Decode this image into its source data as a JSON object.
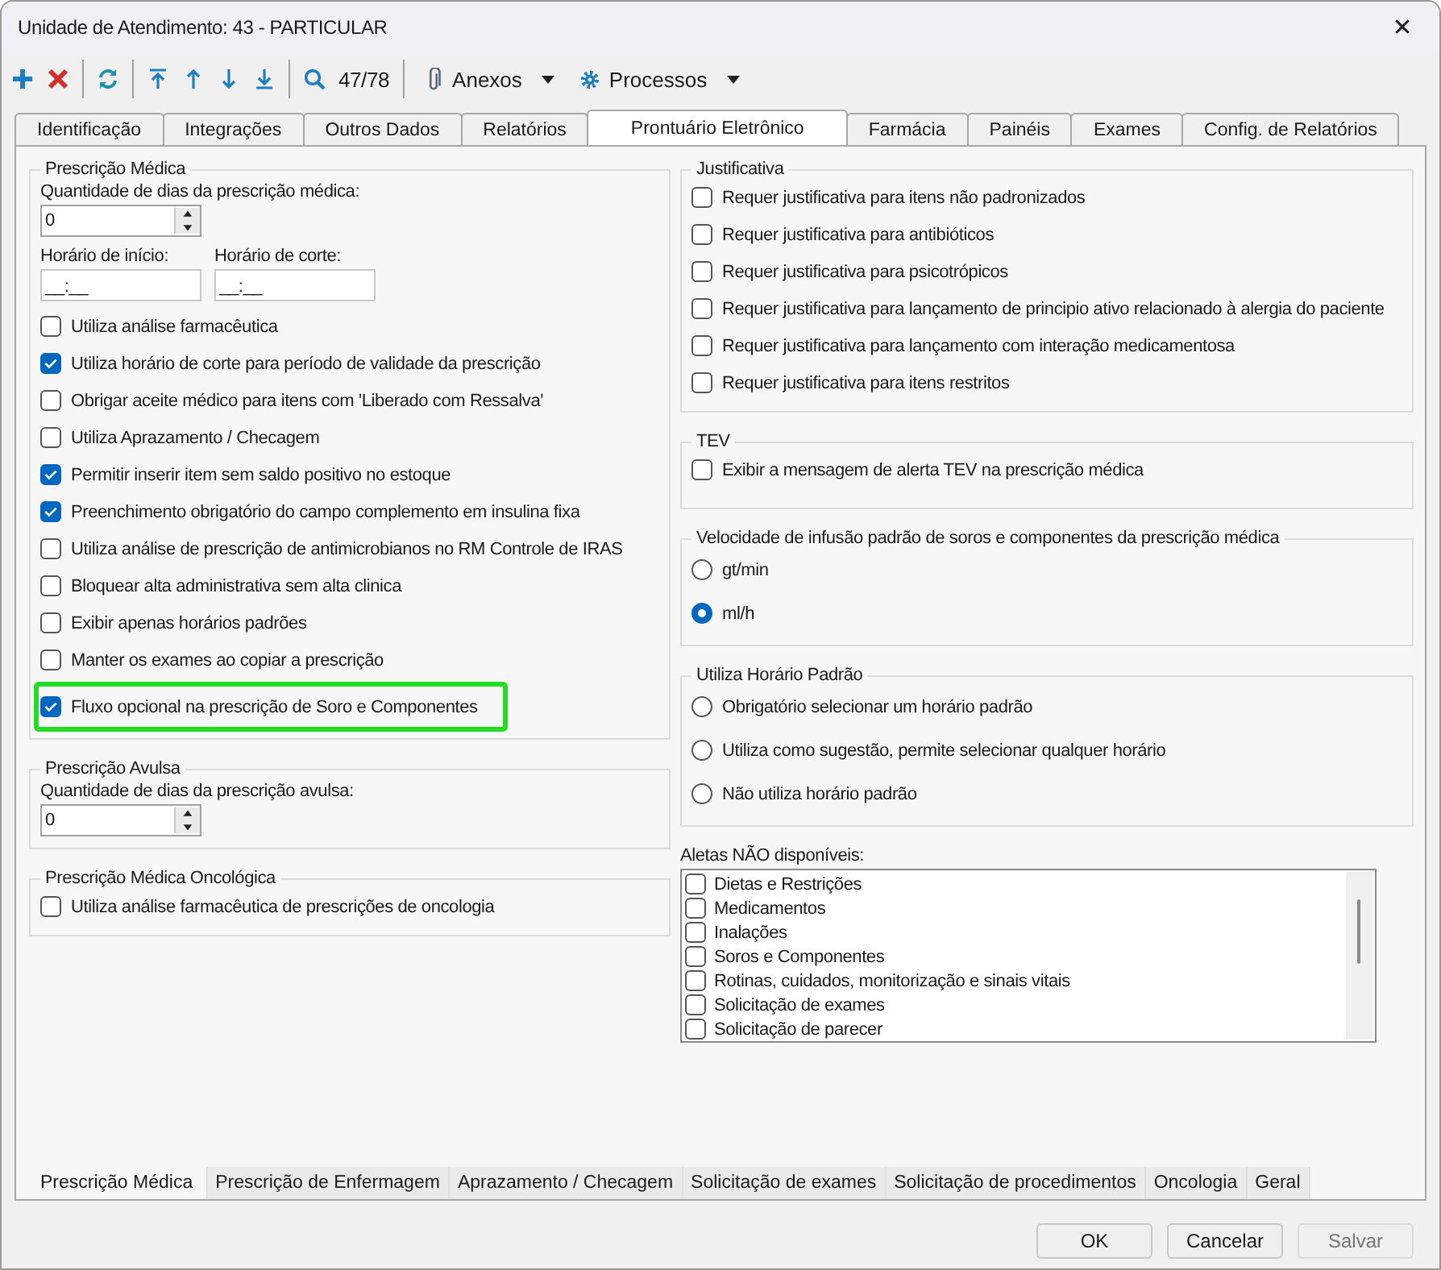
{
  "window": {
    "title": "Unidade de Atendimento: 43 - PARTICULAR",
    "close": "✕"
  },
  "toolbar": {
    "counter": "47/78",
    "menus": [
      {
        "label": "Anexos"
      },
      {
        "label": "Processos"
      }
    ]
  },
  "top_tabs": [
    {
      "label": "Identificação",
      "selected": false
    },
    {
      "label": "Integrações",
      "selected": false
    },
    {
      "label": "Outros Dados",
      "selected": false
    },
    {
      "label": "Relatórios",
      "selected": false
    },
    {
      "label": "Prontuário Eletrônico",
      "selected": true
    },
    {
      "label": "Farmácia",
      "selected": false
    },
    {
      "label": "Painéis",
      "selected": false
    },
    {
      "label": "Exames",
      "selected": false
    },
    {
      "label": "Config. de Relatórios",
      "selected": false
    }
  ],
  "prescricao_medica": {
    "title": "Prescrição Médica",
    "days_label": "Quantidade de dias da prescrição médica:",
    "days_value": "0",
    "start_label": "Horário de início:",
    "start_value": "__:__",
    "cut_label": "Horário de corte:",
    "cut_value": "__:__",
    "options": [
      {
        "label": "Utiliza análise farmacêutica",
        "checked": false,
        "highlighted": false
      },
      {
        "label": "Utiliza horário de corte para período de validade da prescrição",
        "checked": true,
        "highlighted": false
      },
      {
        "label": "Obrigar aceite médico para itens com 'Liberado com Ressalva'",
        "checked": false,
        "highlighted": false
      },
      {
        "label": "Utiliza Aprazamento / Checagem",
        "checked": false,
        "highlighted": false
      },
      {
        "label": "Permitir inserir item sem saldo positivo no estoque",
        "checked": true,
        "highlighted": false
      },
      {
        "label": "Preenchimento obrigatório do campo complemento em insulina fixa",
        "checked": true,
        "highlighted": false
      },
      {
        "label": "Utiliza análise de prescrição de antimicrobianos no RM Controle de IRAS",
        "checked": false,
        "highlighted": false
      },
      {
        "label": "Bloquear alta administrativa sem alta clinica",
        "checked": false,
        "highlighted": false
      },
      {
        "label": "Exibir apenas horários padrões",
        "checked": false,
        "highlighted": false
      },
      {
        "label": "Manter os exames ao copiar a prescrição",
        "checked": false,
        "highlighted": false
      },
      {
        "label": "Fluxo opcional na prescrição de Soro e Componentes",
        "checked": true,
        "highlighted": true
      }
    ]
  },
  "prescricao_avulsa": {
    "title": "Prescrição Avulsa",
    "days_label": "Quantidade de dias da prescrição avulsa:",
    "days_value": "0"
  },
  "oncologica": {
    "title": "Prescrição Médica Oncológica",
    "options": [
      {
        "label": "Utiliza análise farmacêutica de prescrições de oncologia",
        "checked": false
      }
    ]
  },
  "justificativa": {
    "title": "Justificativa",
    "options": [
      {
        "label": "Requer justificativa para itens não padronizados",
        "checked": false
      },
      {
        "label": "Requer justificativa para antibióticos",
        "checked": false
      },
      {
        "label": "Requer justificativa para psicotrópicos",
        "checked": false
      },
      {
        "label": "Requer justificativa para lançamento de principio ativo relacionado à alergia do paciente",
        "checked": false
      },
      {
        "label": "Requer justificativa para lançamento com interação medicamentosa",
        "checked": false
      },
      {
        "label": "Requer justificativa para itens restritos",
        "checked": false
      }
    ]
  },
  "tev": {
    "title": "TEV",
    "options": [
      {
        "label": "Exibir a mensagem de alerta TEV na prescrição médica",
        "checked": false
      }
    ]
  },
  "velocidade": {
    "title": "Velocidade de infusão padrão de soros e componentes da prescrição médica",
    "options": [
      {
        "label": "gt/min",
        "selected": false
      },
      {
        "label": "ml/h",
        "selected": true
      }
    ]
  },
  "horario_padrao": {
    "title": "Utiliza Horário Padrão",
    "options": [
      {
        "label": "Obrigatório selecionar um horário padrão",
        "selected": false
      },
      {
        "label": "Utiliza como sugestão, permite selecionar qualquer horário",
        "selected": false
      },
      {
        "label": "Não utiliza horário padrão",
        "selected": false
      }
    ]
  },
  "alertas": {
    "label": "Aletas NÃO disponíveis:",
    "items": [
      {
        "label": "Dietas e Restrições",
        "checked": false
      },
      {
        "label": "Medicamentos",
        "checked": false
      },
      {
        "label": "Inalações",
        "checked": false
      },
      {
        "label": "Soros e Componentes",
        "checked": false
      },
      {
        "label": "Rotinas, cuidados, monitorização e sinais vitais",
        "checked": false
      },
      {
        "label": "Solicitação de exames",
        "checked": false
      },
      {
        "label": "Solicitação de parecer",
        "checked": false
      }
    ]
  },
  "bottom_tabs": [
    {
      "label": "Prescrição Médica",
      "selected": true
    },
    {
      "label": "Prescrição de Enfermagem",
      "selected": false
    },
    {
      "label": "Aprazamento / Checagem",
      "selected": false
    },
    {
      "label": "Solicitação de exames",
      "selected": false
    },
    {
      "label": "Solicitação de procedimentos",
      "selected": false
    },
    {
      "label": "Oncologia",
      "selected": false
    },
    {
      "label": "Geral",
      "selected": false
    }
  ],
  "buttons": [
    {
      "label": "OK",
      "disabled": false
    },
    {
      "label": "Cancelar",
      "disabled": false
    },
    {
      "label": "Salvar",
      "disabled": true
    }
  ]
}
